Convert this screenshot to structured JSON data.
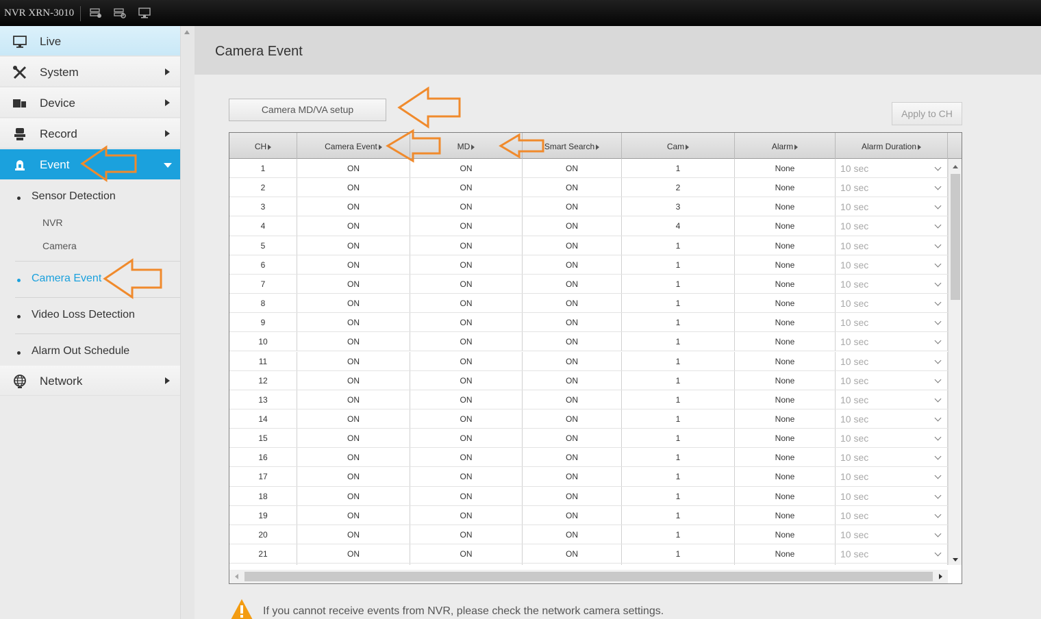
{
  "topbar": {
    "title": "NVR XRN-3010",
    "icons": [
      "server-alert-icon",
      "server-settings-icon",
      "monitor-icon"
    ]
  },
  "sidebar": {
    "menu": [
      {
        "label": "Live",
        "icon": "monitor-icon"
      },
      {
        "label": "System",
        "icon": "tools-icon"
      },
      {
        "label": "Device",
        "icon": "device-icon"
      },
      {
        "label": "Record",
        "icon": "record-icon"
      },
      {
        "label": "Event",
        "icon": "event-icon"
      },
      {
        "label": "Network",
        "icon": "globe-icon"
      }
    ],
    "event_sub": {
      "sensor_detection": "Sensor Detection",
      "nvr": "NVR",
      "camera": "Camera",
      "camera_event": "Camera Event",
      "video_loss": "Video Loss Detection",
      "alarm_out": "Alarm Out Schedule"
    }
  },
  "page": {
    "title": "Camera Event",
    "md_button": "Camera MD/VA setup",
    "apply_button": "Apply to CH",
    "warning": "If you cannot receive events from NVR, please check the network camera settings."
  },
  "table": {
    "columns": [
      "CH",
      "Camera Event",
      "MD",
      "Smart Search",
      "Cam",
      "Alarm",
      "Alarm Duration"
    ],
    "rows": [
      [
        "1",
        "ON",
        "ON",
        "ON",
        "1",
        "None",
        "10 sec"
      ],
      [
        "2",
        "ON",
        "ON",
        "ON",
        "2",
        "None",
        "10 sec"
      ],
      [
        "3",
        "ON",
        "ON",
        "ON",
        "3",
        "None",
        "10 sec"
      ],
      [
        "4",
        "ON",
        "ON",
        "ON",
        "4",
        "None",
        "10 sec"
      ],
      [
        "5",
        "ON",
        "ON",
        "ON",
        "1",
        "None",
        "10 sec"
      ],
      [
        "6",
        "ON",
        "ON",
        "ON",
        "1",
        "None",
        "10 sec"
      ],
      [
        "7",
        "ON",
        "ON",
        "ON",
        "1",
        "None",
        "10 sec"
      ],
      [
        "8",
        "ON",
        "ON",
        "ON",
        "1",
        "None",
        "10 sec"
      ],
      [
        "9",
        "ON",
        "ON",
        "ON",
        "1",
        "None",
        "10 sec"
      ],
      [
        "10",
        "ON",
        "ON",
        "ON",
        "1",
        "None",
        "10 sec"
      ],
      [
        "11",
        "ON",
        "ON",
        "ON",
        "1",
        "None",
        "10 sec"
      ],
      [
        "12",
        "ON",
        "ON",
        "ON",
        "1",
        "None",
        "10 sec"
      ],
      [
        "13",
        "ON",
        "ON",
        "ON",
        "1",
        "None",
        "10 sec"
      ],
      [
        "14",
        "ON",
        "ON",
        "ON",
        "1",
        "None",
        "10 sec"
      ],
      [
        "15",
        "ON",
        "ON",
        "ON",
        "1",
        "None",
        "10 sec"
      ],
      [
        "16",
        "ON",
        "ON",
        "ON",
        "1",
        "None",
        "10 sec"
      ],
      [
        "17",
        "ON",
        "ON",
        "ON",
        "1",
        "None",
        "10 sec"
      ],
      [
        "18",
        "ON",
        "ON",
        "ON",
        "1",
        "None",
        "10 sec"
      ],
      [
        "19",
        "ON",
        "ON",
        "ON",
        "1",
        "None",
        "10 sec"
      ],
      [
        "20",
        "ON",
        "ON",
        "ON",
        "1",
        "None",
        "10 sec"
      ],
      [
        "21",
        "ON",
        "ON",
        "ON",
        "1",
        "None",
        "10 sec"
      ]
    ]
  },
  "colors": {
    "accent": "#1ba1dd",
    "annotation_arrow": "#f08a2c",
    "warning": "#f39c12"
  }
}
